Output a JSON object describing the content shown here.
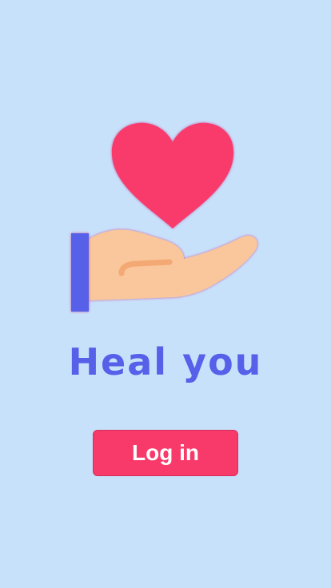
{
  "app": {
    "title": "Heal you"
  },
  "actions": {
    "login_label": "Log in"
  },
  "illustration": {
    "icon": "hand-holding-heart-icon",
    "heart_color": "#f83a6b",
    "hand_color": "#f9c79b",
    "cuff_color": "#5660e8"
  },
  "colors": {
    "background": "#c8e1fb",
    "title": "#5660e8",
    "button": "#f83a6b",
    "button_text": "#ffffff"
  }
}
